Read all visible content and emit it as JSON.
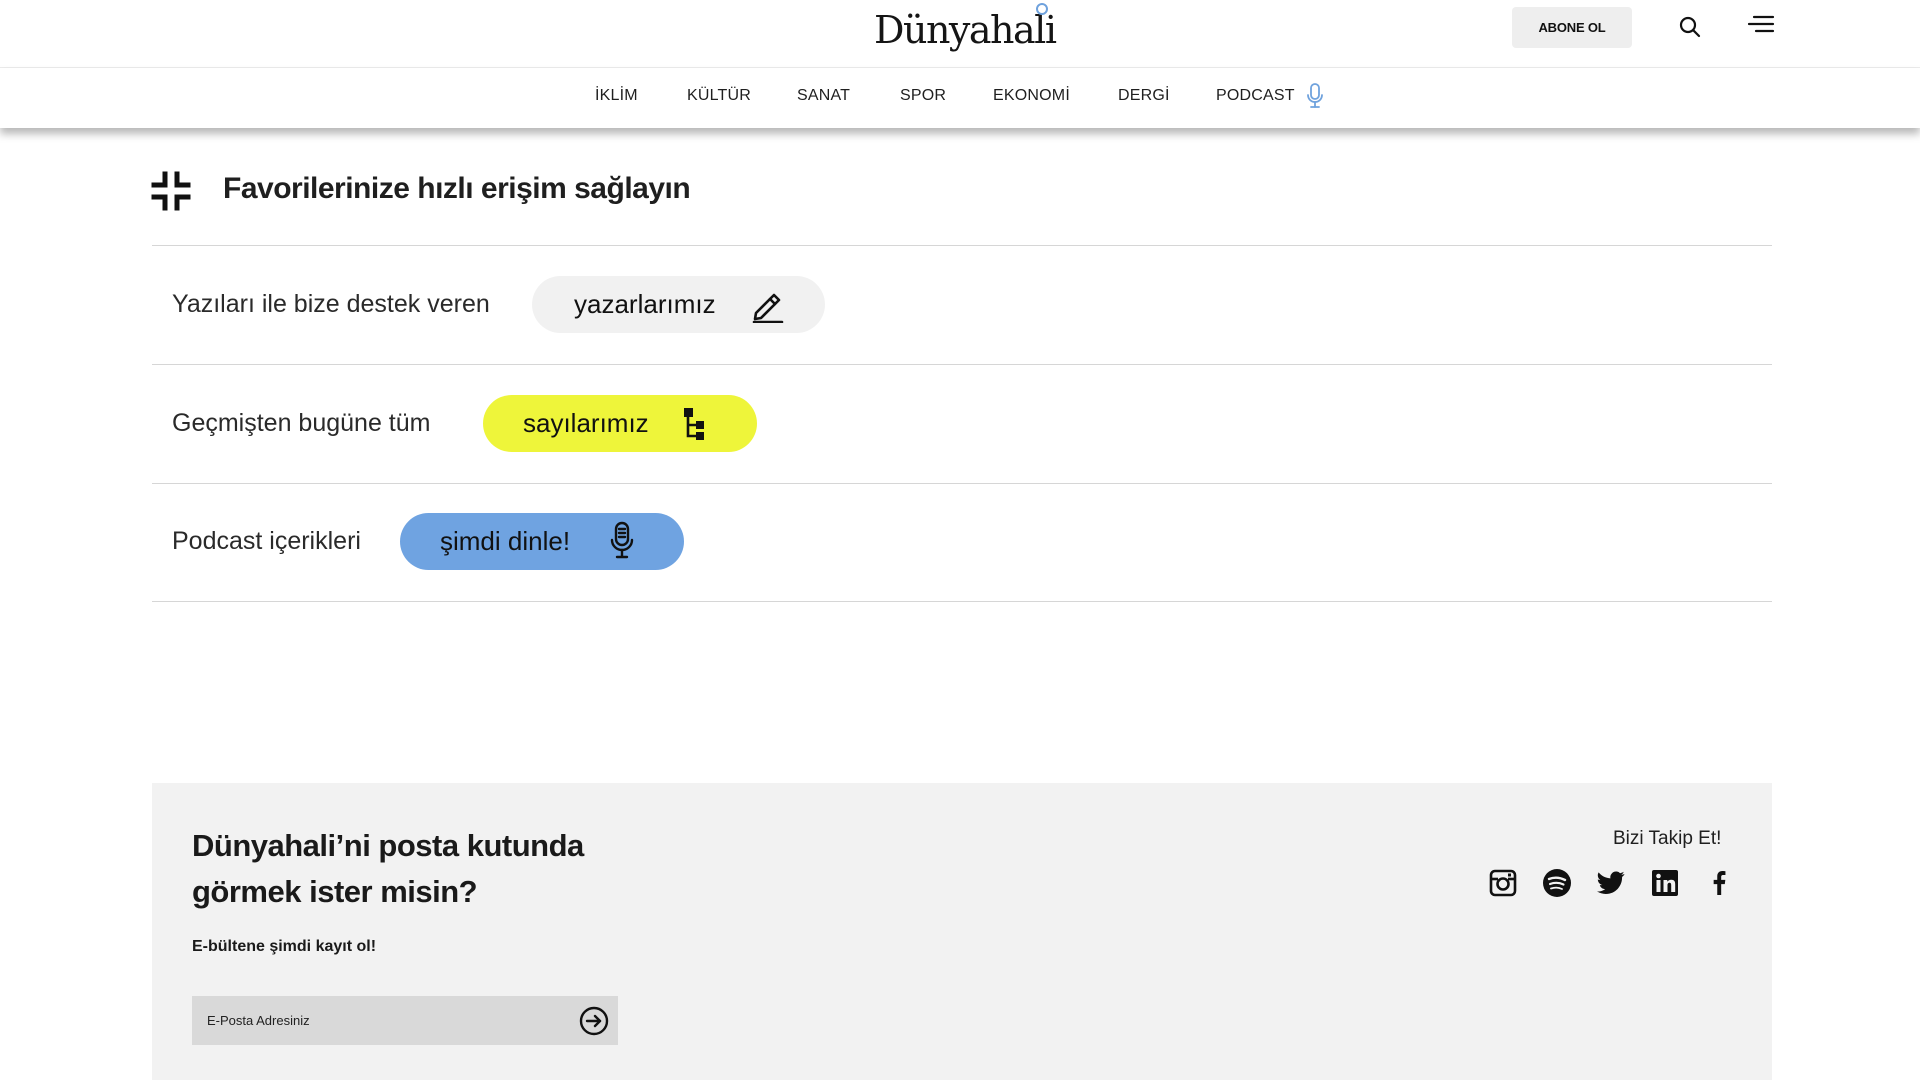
{
  "header": {
    "logo": "Dünyahali",
    "subscribe_label": "ABONE OL",
    "search_icon": "search-icon",
    "menu_icon": "hamburger-menu-icon"
  },
  "nav": {
    "items": [
      "İKLİM",
      "KÜLTÜR",
      "SANAT",
      "SPOR",
      "EKONOMİ",
      "DERGİ",
      "PODCAST"
    ],
    "podcast_icon": "microphone-icon",
    "accent_color": "#6fa2dd"
  },
  "favorites": {
    "icon": "collapse-icon",
    "title": "Favorilerinize hızlı erişim sağlayın",
    "rows": [
      {
        "label": "Yazıları ile bize destek veren",
        "pill": "yazarlarımız",
        "icon": "pencil-icon",
        "color": "#f1f1f1"
      },
      {
        "label": "Geçmişten bugüne tüm",
        "pill": "sayılarımız",
        "icon": "tree-structure-icon",
        "color": "#eef53a"
      },
      {
        "label": "Podcast içerikleri",
        "pill": "şimdi dinle!",
        "icon": "microphone-icon",
        "color": "#6fa3e1"
      }
    ]
  },
  "newsletter": {
    "title": "Dünyahali’ni posta kutunda görmek ister misin?",
    "subtitle": "E-bültene şimdi kayıt ol!",
    "placeholder": "E-Posta Adresiniz",
    "submit_icon": "arrow-right-circle-icon"
  },
  "follow": {
    "title": "Bizi Takip Et!",
    "socials": [
      "instagram-icon",
      "spotify-icon",
      "twitter-icon",
      "linkedin-icon",
      "facebook-icon"
    ]
  }
}
